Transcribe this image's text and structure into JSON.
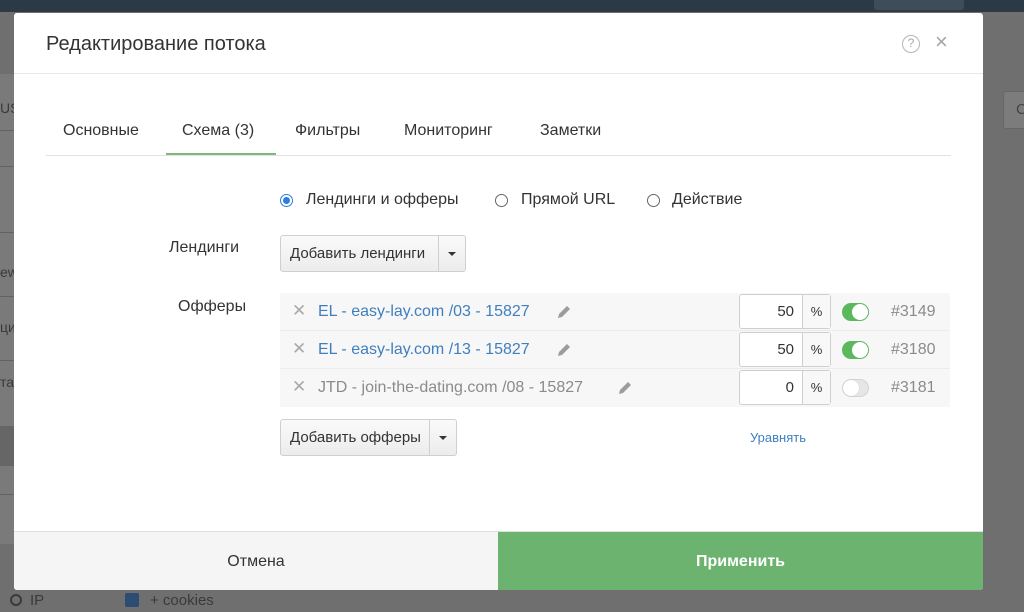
{
  "background": {
    "left_fragments": [
      "US",
      "ew",
      "ци",
      "та"
    ],
    "right_button": "С",
    "bottom_text_1": "IP",
    "bottom_text_2": "+ cookies"
  },
  "modal": {
    "title": "Редактирование потока",
    "help_glyph": "?",
    "close_glyph": "×"
  },
  "tabs": [
    {
      "label": "Основные",
      "active": false
    },
    {
      "label": "Схема (3)",
      "active": true
    },
    {
      "label": "Фильтры",
      "active": false
    },
    {
      "label": "Мониторинг",
      "active": false
    },
    {
      "label": "Заметки",
      "active": false
    }
  ],
  "mode": {
    "options": [
      {
        "label": "Лендинги и офферы",
        "selected": true
      },
      {
        "label": "Прямой URL",
        "selected": false
      },
      {
        "label": "Действие",
        "selected": false
      }
    ]
  },
  "landings": {
    "label": "Лендинги",
    "add_button": "Добавить лендинги"
  },
  "offers": {
    "label": "Офферы",
    "percent_sign": "%",
    "rows": [
      {
        "name": "EL - easy-lay.com /03 - 15827",
        "weight": "50",
        "enabled": true,
        "id": "#3149"
      },
      {
        "name": "EL - easy-lay.com /13 - 15827",
        "weight": "50",
        "enabled": true,
        "id": "#3180"
      },
      {
        "name": "JTD - join-the-dating.com /08 - 15827",
        "weight": "0",
        "enabled": false,
        "id": "#3181"
      }
    ],
    "add_button": "Добавить офферы",
    "equalize_link": "Уравнять"
  },
  "footer": {
    "cancel": "Отмена",
    "apply": "Применить"
  },
  "colors": {
    "accent_green": "#6cb36f",
    "toggle_on": "#5cb85c",
    "link_blue": "#3f7fbf",
    "radio_blue": "#2b7de0"
  },
  "icons": {
    "help": "help-circle-icon",
    "close": "close-icon",
    "remove": "remove-x-icon",
    "edit": "pencil-icon",
    "dropdown": "caret-down-icon"
  }
}
